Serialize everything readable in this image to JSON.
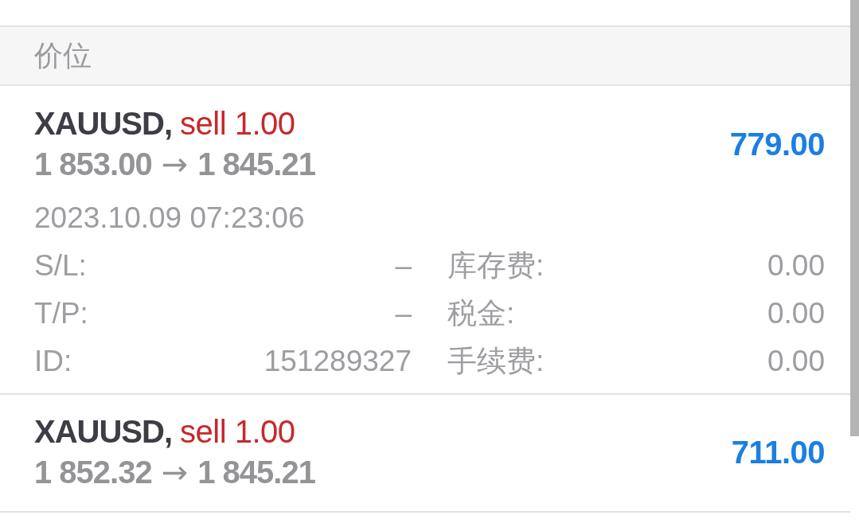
{
  "header": {
    "title": "价位"
  },
  "positions": [
    {
      "symbol": "XAUUSD,",
      "trade": "sell 1.00",
      "open_price": "1 853.00",
      "arrow": "→",
      "current_price": "1 845.21",
      "profit": "779.00",
      "time": "2023.10.09 07:23:06",
      "details": [
        {
          "label": "S/L:",
          "value": "–"
        },
        {
          "label": "库存费:",
          "value": "0.00"
        },
        {
          "label": "T/P:",
          "value": "–"
        },
        {
          "label": "税金:",
          "value": "0.00"
        },
        {
          "label": "ID:",
          "value": "151289327"
        },
        {
          "label": "手续费:",
          "value": "0.00"
        }
      ]
    },
    {
      "symbol": "XAUUSD,",
      "trade": "sell 1.00",
      "open_price": "1 852.32",
      "arrow": "→",
      "current_price": "1 845.21",
      "profit": "711.00"
    }
  ]
}
